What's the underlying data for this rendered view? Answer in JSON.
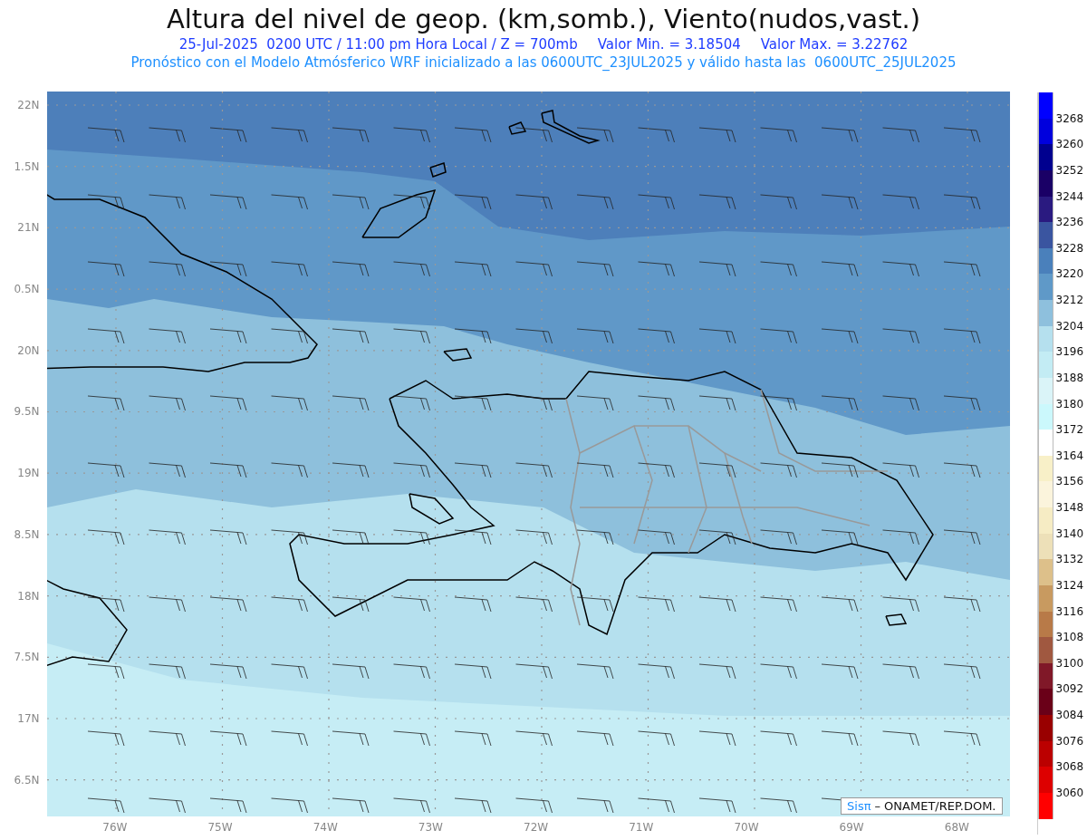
{
  "title": "Altura del nivel de geop. (km,somb.), Viento(nudos,vast.)",
  "subtitle": {
    "valid_time": "25-Jul-2025  0200 UTC / 11:00 pm Hora Local / Z = 700mb",
    "min_value": "Valor Min. = 3.18504",
    "max_value": "Valor Max. = 3.22762"
  },
  "forecast_note": "Pronóstico con el Modelo Atmósferico WRF inicializado a las 0600UTC_23JUL2025 y válido hasta las  0600UTC_25JUL2025",
  "y_axis": [
    "22N",
    "1.5N",
    "21N",
    "0.5N",
    "20N",
    "9.5N",
    "19N",
    "8.5N",
    "18N",
    "7.5N",
    "17N",
    "6.5N"
  ],
  "x_axis": [
    "76W",
    "75W",
    "74W",
    "73W",
    "72W",
    "71W",
    "70W",
    "69W",
    "68W"
  ],
  "credit": {
    "brand": "Sisπ",
    "text": "– ONAMET/REP.DOM."
  },
  "colorbar": [
    {
      "color": "#0000ff",
      "label": "3268"
    },
    {
      "color": "#0000dd",
      "label": "3260"
    },
    {
      "color": "#00008f",
      "label": "3252"
    },
    {
      "color": "#1a0066",
      "label": "3244"
    },
    {
      "color": "#2a1a80",
      "label": "3236"
    },
    {
      "color": "#3a55a0",
      "label": "3228"
    },
    {
      "color": "#4a80bb",
      "label": "3220"
    },
    {
      "color": "#5f99c8",
      "label": "3212"
    },
    {
      "color": "#8ec0dd",
      "label": "3204"
    },
    {
      "color": "#b5e0ee",
      "label": "3196"
    },
    {
      "color": "#c3ecf4",
      "label": "3188"
    },
    {
      "color": "#daf4f8",
      "label": "3180"
    },
    {
      "color": "#cbf8fc",
      "label": "3172"
    },
    {
      "color": "#ffffff",
      "label": "3164"
    },
    {
      "color": "#f8f0c8",
      "label": "3156"
    },
    {
      "color": "#fbf4dc",
      "label": "3148"
    },
    {
      "color": "#f6ecc4",
      "label": "3140"
    },
    {
      "color": "#ede0b8",
      "label": "3132"
    },
    {
      "color": "#ddc08a",
      "label": "3124"
    },
    {
      "color": "#c89a60",
      "label": "3116"
    },
    {
      "color": "#b87a48",
      "label": "3108"
    },
    {
      "color": "#a05840",
      "label": "3100"
    },
    {
      "color": "#801828",
      "label": "3092"
    },
    {
      "color": "#6a0018",
      "label": "3084"
    },
    {
      "color": "#990000",
      "label": "3076"
    },
    {
      "color": "#bb0000",
      "label": "3068"
    },
    {
      "color": "#dd0000",
      "label": "3060"
    },
    {
      "color": "#ff0000"
    }
  ]
}
